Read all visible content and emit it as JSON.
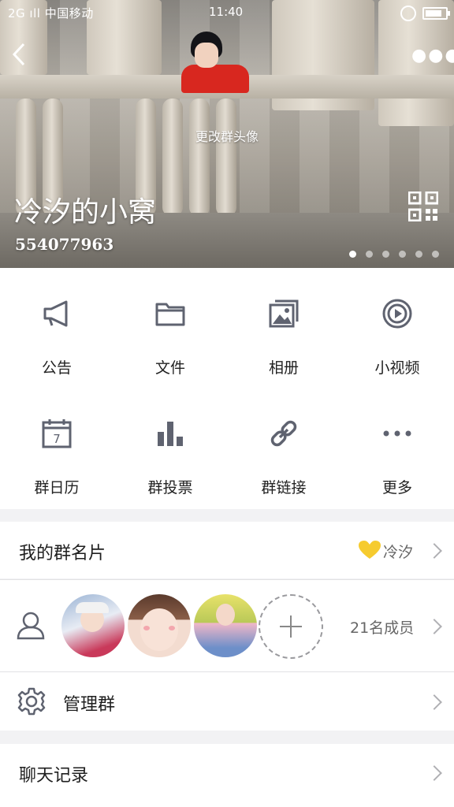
{
  "status_bar": {
    "carrier": "2G ıll 中国移动",
    "time": "11:40"
  },
  "header": {
    "change_avatar_label": "更改群头像",
    "group_name": "冷汐的小窝",
    "group_id": "554077963"
  },
  "features": [
    {
      "label": "公告",
      "icon": "megaphone-icon"
    },
    {
      "label": "文件",
      "icon": "folder-icon"
    },
    {
      "label": "相册",
      "icon": "photo-album-icon"
    },
    {
      "label": "小视频",
      "icon": "video-play-icon"
    },
    {
      "label": "群日历",
      "icon": "calendar-icon"
    },
    {
      "label": "群投票",
      "icon": "bar-chart-icon"
    },
    {
      "label": "群链接",
      "icon": "link-icon"
    },
    {
      "label": "更多",
      "icon": "more-dots-icon"
    }
  ],
  "group_card": {
    "label": "我的群名片",
    "value": "冷汐"
  },
  "members": {
    "count_label": "21名成员"
  },
  "manage": {
    "label": "管理群"
  },
  "chat_history": {
    "label": "聊天记录"
  },
  "colors": {
    "icon_gray": "#5f6370",
    "text": "#1f1f1f",
    "divider": "#e1e1e4",
    "background": "#f2f2f4"
  }
}
